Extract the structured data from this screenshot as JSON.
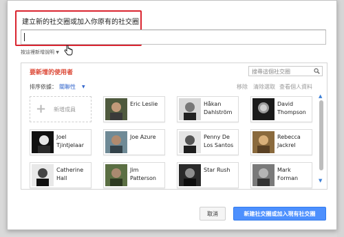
{
  "dialog": {
    "name_label": "建立新的社交圈或加入你原有的社交圈",
    "name_value": "",
    "add_description": "按這裡新增說明",
    "add_description_arrow": "▼"
  },
  "panel": {
    "title": "要新增的使用者",
    "search_placeholder": "搜尋這個社交圈",
    "sort_label": "排序依據：",
    "sort_value": "關聯性",
    "sort_arrow": "▼",
    "actions": {
      "remove": "移除",
      "clear_selection": "清除選取",
      "view_profile": "查看個人資料"
    },
    "add_person_label": "新增成員",
    "add_person_plus": "+",
    "scroll_up": "▲",
    "scroll_down": "▼"
  },
  "people": [
    {
      "name": "Eric Leslie"
    },
    {
      "name": "Håkan Dahlström"
    },
    {
      "name": "David Thompson"
    },
    {
      "name": "Joel Tjintjelaar"
    },
    {
      "name": "Joe Azure"
    },
    {
      "name": "Penny De Los Santos"
    },
    {
      "name": "Rebecca Jackrel"
    },
    {
      "name": "Catherine Hall"
    },
    {
      "name": "Jim Patterson"
    },
    {
      "name": "Star Rush"
    },
    {
      "name": "Mark Forman"
    }
  ],
  "buttons": {
    "cancel": "取消",
    "primary": "新建社交圈或加入現有社交圈"
  },
  "colors": {
    "highlight_border": "#d9232e",
    "title_red": "#dd4b39",
    "link_blue": "#3366cc",
    "primary_button": "#4d90fe"
  }
}
